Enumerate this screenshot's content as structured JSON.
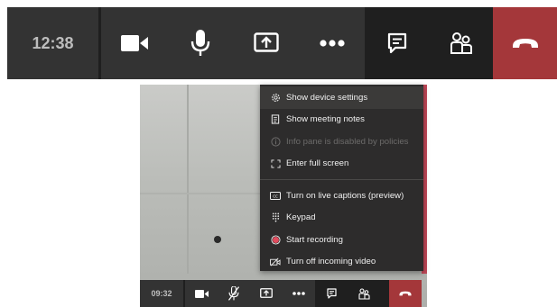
{
  "top_toolbar": {
    "time": "12:38",
    "buttons": [
      "camera-icon",
      "microphone-icon",
      "share-screen-icon",
      "more-options-icon",
      "chat-icon",
      "participants-icon",
      "hang-up-icon"
    ]
  },
  "context_menu": {
    "items": [
      {
        "label": "Show device settings",
        "icon": "gear-icon",
        "disabled": false
      },
      {
        "label": "Show meeting notes",
        "icon": "notes-icon",
        "disabled": false
      },
      {
        "label": "Info pane is disabled by policies",
        "icon": "info-icon",
        "disabled": true
      },
      {
        "label": "Enter full screen",
        "icon": "fullscreen-icon",
        "disabled": false
      },
      {
        "label": "Turn on live captions (preview)",
        "icon": "captions-icon",
        "disabled": false
      },
      {
        "label": "Keypad",
        "icon": "keypad-icon",
        "disabled": false
      },
      {
        "label": "Start recording",
        "icon": "record-icon",
        "disabled": false
      },
      {
        "label": "Turn off incoming video",
        "icon": "video-off-icon",
        "disabled": false
      }
    ]
  },
  "bottom_toolbar": {
    "time": "09:32",
    "buttons": [
      "camera-icon",
      "microphone-muted-icon",
      "share-screen-icon",
      "more-options-icon",
      "chat-icon",
      "participants-icon",
      "hang-up-icon"
    ]
  },
  "colors": {
    "toolbar_bg": "#333333",
    "toolbar_dark": "#1f1f1f",
    "hangup_red": "#a4373a",
    "menu_bg": "#2d2c2c",
    "record_red": "#e04c5e"
  }
}
